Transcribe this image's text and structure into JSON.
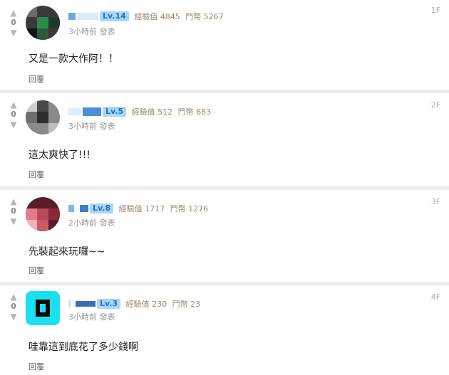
{
  "comments": [
    {
      "floor": "1F",
      "votes": "0",
      "level": "Lv.14",
      "exp_label": "經驗值",
      "exp_value": "4845",
      "coin_label": "鬥幣",
      "coin_value": "5267",
      "time": "3小時前 發表",
      "text": "又是一款大作阿！！",
      "reply": "回覆"
    },
    {
      "floor": "2F",
      "votes": "0",
      "level": "Lv.5",
      "exp_label": "經驗值",
      "exp_value": "512",
      "coin_label": "鬥幣",
      "coin_value": "683",
      "time": "3小時前 發表",
      "text": "這太爽快了!!!",
      "reply": "回覆"
    },
    {
      "floor": "3F",
      "votes": "0",
      "level": "Lv.8",
      "exp_label": "經驗值",
      "exp_value": "1717",
      "coin_label": "鬥幣",
      "coin_value": "1276",
      "time": "2小時前 發表",
      "text": "先裝起來玩囉~~",
      "reply": "回覆"
    },
    {
      "floor": "4F",
      "votes": "0",
      "level": "Lv.3",
      "exp_label": "經驗值",
      "exp_value": "230",
      "coin_label": "鬥幣",
      "coin_value": "23",
      "time": "3小時前 發表",
      "text": "哇靠這到底花了多少錢啊",
      "reply": "回覆"
    }
  ],
  "icons": {
    "upvote": "up-arrow-icon",
    "downvote": "down-arrow-icon"
  },
  "colors": {
    "level_badge_bg": "#a6d7f7",
    "level_badge_text": "#2f6fb5",
    "stat_text": "#9b8a6f"
  }
}
